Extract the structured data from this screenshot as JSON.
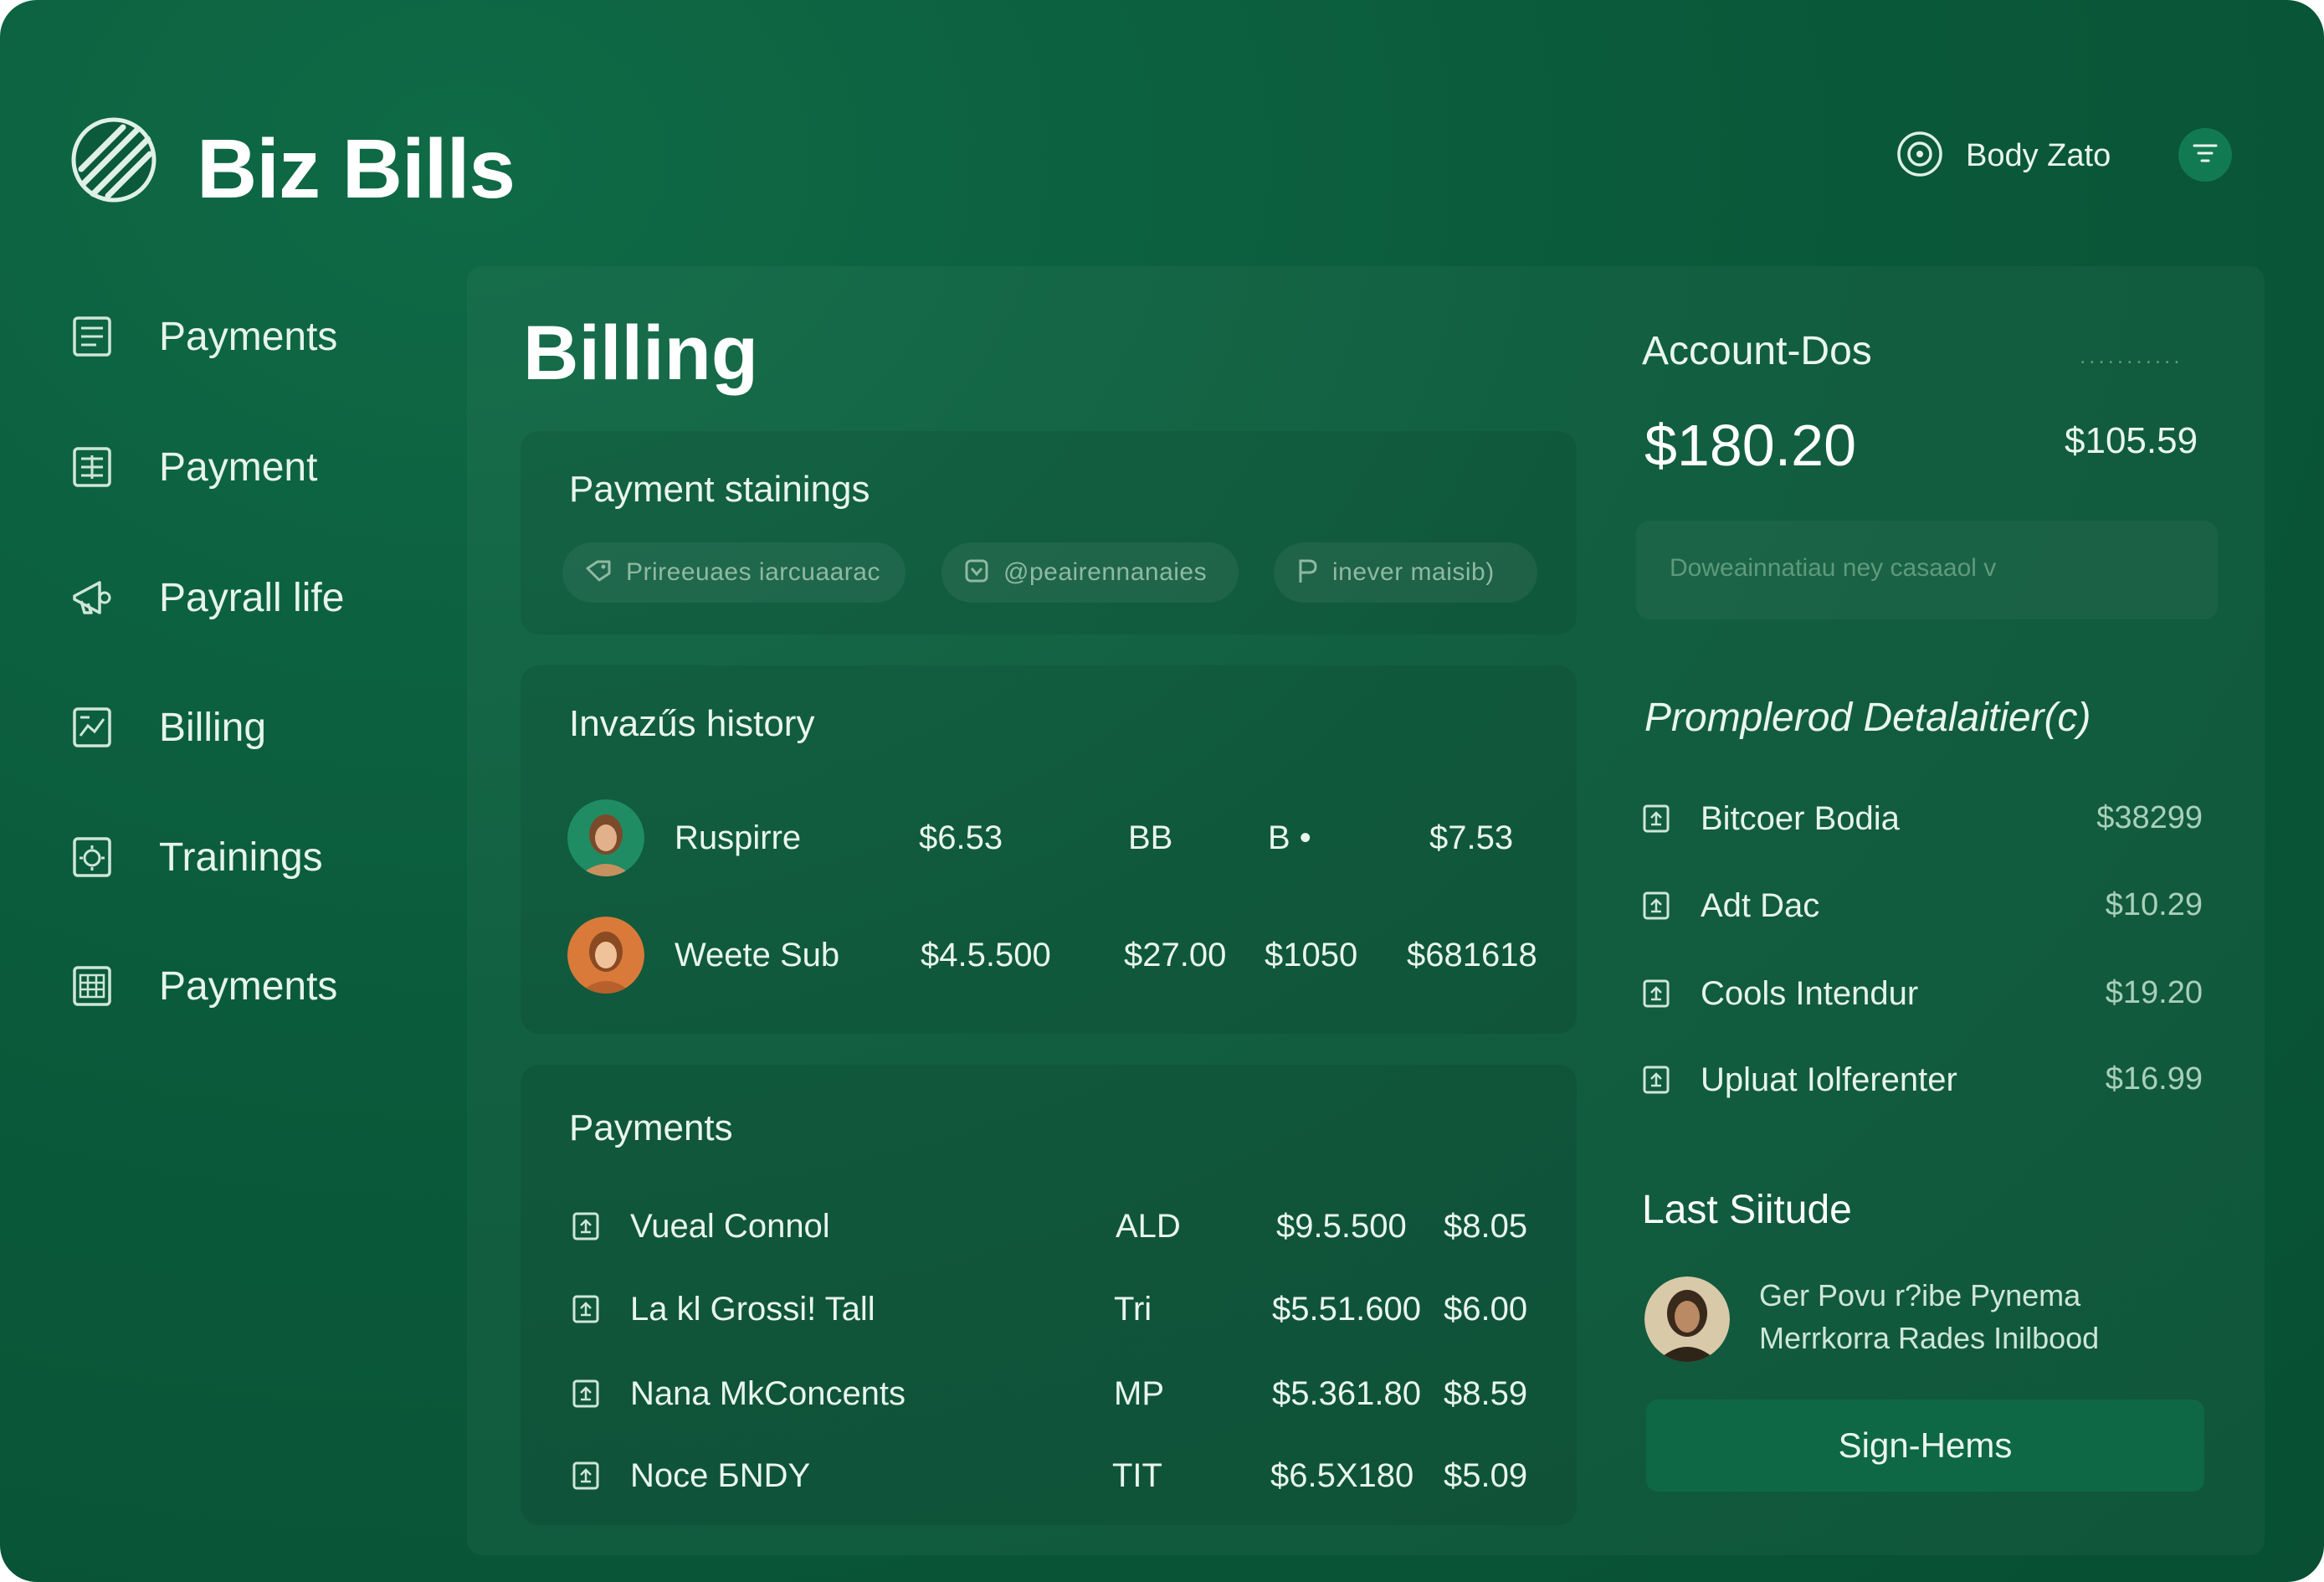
{
  "app": {
    "title": "Biz Bills",
    "logo_icon": "striped-globe-icon"
  },
  "header": {
    "user_name": "Body Zato",
    "user_icon": "user-circle-icon",
    "filter_icon": "filter-icon"
  },
  "sidebar": {
    "items": [
      {
        "label": "Payments",
        "icon": "document-icon"
      },
      {
        "label": "Payment",
        "icon": "document-icon"
      },
      {
        "label": "Payrall life",
        "icon": "megaphone-icon"
      },
      {
        "label": "Billing",
        "icon": "chart-doc-icon"
      },
      {
        "label": "Trainings",
        "icon": "gear-doc-icon"
      },
      {
        "label": "Payments",
        "icon": "table-doc-icon"
      }
    ]
  },
  "main": {
    "title": "Billing",
    "stainings": {
      "title": "Payment stainings",
      "chips": [
        {
          "text": "Prireeuaes iarcuaarac",
          "icon": "tag-icon"
        },
        {
          "text": "@peairennanaies",
          "icon": "badge-icon"
        },
        {
          "text": "inever maisib)",
          "icon": "p-icon"
        }
      ]
    },
    "history": {
      "title": "Invazűs history",
      "rows": [
        {
          "name": "Ruspirre",
          "c1": "$6.53",
          "c2": "BB",
          "c3": "B •",
          "c4": "$7.53"
        },
        {
          "name": "Weete Sub",
          "c1": "$4.5.500",
          "c2": "$27.00",
          "c3": "$1050",
          "c4": "$681618"
        }
      ]
    },
    "payments": {
      "title": "Payments",
      "rows": [
        {
          "name": "Vueal Connol",
          "code": "ALD",
          "amount": "$9.5.500",
          "fee": "$8.05"
        },
        {
          "name": "La kl Grossi! Tall",
          "code": "Tri",
          "amount": "$5.51.600",
          "fee": "$6.00"
        },
        {
          "name": "Nana MkConcents",
          "code": "MP",
          "amount": "$5.361.80",
          "fee": "$8.59"
        },
        {
          "name": "Noce  БNDY",
          "code": "TIT",
          "amount": "$6.5X180",
          "fee": "$5.09"
        }
      ]
    }
  },
  "account": {
    "title": "Account-Dos",
    "dots": "...........",
    "balance": "$180.20",
    "secondary": "$105.59",
    "input_placeholder": "Doweainnatiau ney casaaol v"
  },
  "details": {
    "title": "Promplerod Detalaitier(c)",
    "rows": [
      {
        "label": "Bitcoer Bodia",
        "value": "$38299"
      },
      {
        "label": "Adt Dac",
        "value": "$10.29"
      },
      {
        "label": "Cools Intendur",
        "value": "$19.20"
      },
      {
        "label": "Upluat Iolferenter",
        "value": "$16.99"
      }
    ]
  },
  "last": {
    "title": "Last Siitude",
    "line1": "Ger Povu r?ibe Pynema",
    "line2": "Merrkorra Rades Inilbood",
    "button": "Sign-Hems"
  },
  "colors": {
    "background": "#0a5a3b",
    "accent": "#127a52",
    "text": "#e9f6ef"
  }
}
